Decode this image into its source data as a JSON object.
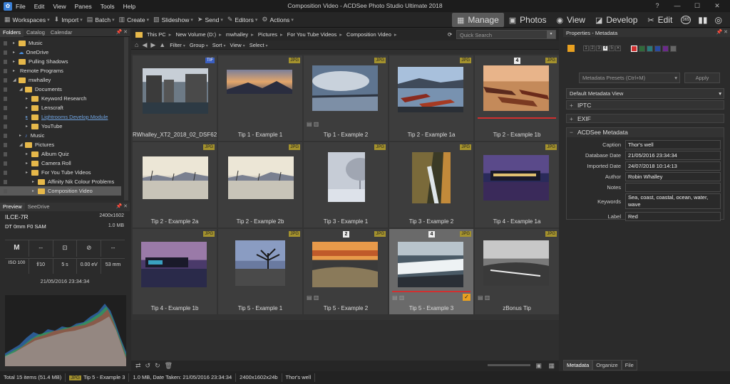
{
  "app": {
    "title": "Composition Video - ACDSee Photo Studio Ultimate 2018"
  },
  "menu": [
    "File",
    "Edit",
    "View",
    "Panes",
    "Tools",
    "Help"
  ],
  "toolbar": {
    "workspaces": "Workspaces",
    "import": "Import",
    "batch": "Batch",
    "create": "Create",
    "slideshow": "Slideshow",
    "send": "Send",
    "editors": "Editors",
    "actions": "Actions"
  },
  "modes": {
    "manage": "Manage",
    "photos": "Photos",
    "view": "View",
    "develop": "Develop",
    "edit": "Edit",
    "badge365": "365"
  },
  "left_tabs": [
    "Folders",
    "Catalog",
    "Calendar"
  ],
  "tree": [
    {
      "label": "Music",
      "depth": 2,
      "type": "folder"
    },
    {
      "label": "OneDrive",
      "depth": 2,
      "type": "cloud"
    },
    {
      "label": "Pulling Shadows",
      "depth": 2,
      "type": "folder"
    },
    {
      "label": "Remote Programs",
      "depth": 2,
      "type": "none"
    },
    {
      "label": "mwhalley",
      "depth": 2,
      "type": "folder"
    },
    {
      "label": "Documents",
      "depth": 3,
      "type": "folder"
    },
    {
      "label": "Keyword Research",
      "depth": 4,
      "type": "folder"
    },
    {
      "label": "Lenscraft",
      "depth": 4,
      "type": "folder"
    },
    {
      "label": "Lightrooms Develop Module",
      "depth": 4,
      "type": "folder",
      "link": true
    },
    {
      "label": "YouTube",
      "depth": 4,
      "type": "folder"
    },
    {
      "label": "Music",
      "depth": 3,
      "type": "music"
    },
    {
      "label": "Pictures",
      "depth": 3,
      "type": "folder"
    },
    {
      "label": "Album Quiz",
      "depth": 4,
      "type": "folder"
    },
    {
      "label": "Camera Roll",
      "depth": 4,
      "type": "folder"
    },
    {
      "label": "For You Tube Videos",
      "depth": 4,
      "type": "folder"
    },
    {
      "label": "Affinity Nik Colour Problems",
      "depth": 5,
      "type": "folder"
    },
    {
      "label": "Composition Video",
      "depth": 5,
      "type": "folder",
      "selected": true
    }
  ],
  "preview_tabs": [
    "Preview",
    "SeeDrive"
  ],
  "camera": {
    "model": "ILCE-7R",
    "resolution": "2400x1602",
    "lens": "DT 0mm F0 SAM",
    "size": "1.0 MB",
    "mode": "M",
    "dash1": "--",
    "dash2": "--",
    "iso": "ISO 100",
    "aperture": "f/10",
    "shutter": "5 s",
    "ev": "0.00 eV",
    "focal": "53 mm",
    "date": "21/05/2016 23:34:34"
  },
  "address": {
    "path": [
      "This PC",
      "New Volume (D:)",
      "mwhalley",
      "Pictures",
      "For You Tube Videos",
      "Composition Video"
    ],
    "search_placeholder": "Quick Search"
  },
  "nav": [
    "Filter",
    "Group",
    "Sort",
    "View",
    "Select"
  ],
  "thumbnails": [
    {
      "caption": "RWhalley_XT2_2018_02_DSF62",
      "badge": "TIF",
      "num": "",
      "img": "city"
    },
    {
      "caption": "Tip 1 - Example 1",
      "badge": "JPG",
      "num": "",
      "img": "lake"
    },
    {
      "caption": "Tip 1 - Example 2",
      "badge": "JPG",
      "num": "",
      "img": "cloud"
    },
    {
      "caption": "Tip 2 - Example 1a",
      "badge": "JPG",
      "num": "",
      "img": "boats"
    },
    {
      "caption": "Tip 2 - Example 1b",
      "badge": "JPG",
      "num": "4",
      "img": "boats2"
    },
    {
      "caption": "Tip 2 - Example 2a",
      "badge": "JPG",
      "num": "",
      "img": "harbour"
    },
    {
      "caption": "Tip 2 - Example 2b",
      "badge": "JPG",
      "num": "",
      "img": "harbour"
    },
    {
      "caption": "Tip 3 - Example 1",
      "badge": "JPG",
      "num": "",
      "img": "mist"
    },
    {
      "caption": "Tip 3 - Example 2",
      "badge": "JPG",
      "num": "",
      "img": "falls"
    },
    {
      "caption": "Tip 4 - Example 1a",
      "badge": "JPG",
      "num": "",
      "img": "dusk"
    },
    {
      "caption": "Tip 4 - Example 1b",
      "badge": "JPG",
      "num": "",
      "img": "dusk2"
    },
    {
      "caption": "Tip 5 - Example 1",
      "badge": "JPG",
      "num": "",
      "img": "tree"
    },
    {
      "caption": "Tip 5 - Example 2",
      "badge": "JPG",
      "num": "2",
      "img": "sunset"
    },
    {
      "caption": "Tip 5 - Example 3",
      "badge": "JPG",
      "num": "4",
      "img": "water",
      "selected": true
    },
    {
      "caption": "zBonus Tip",
      "badge": "JPG",
      "num": "",
      "img": "bw"
    }
  ],
  "right": {
    "header": "Properties - Metadata",
    "presets": "Metadata Presets (Ctrl+M)",
    "apply": "Apply",
    "view": "Default Metadata View",
    "sections": [
      "IPTC",
      "EXIF",
      "ACDSee Metadata"
    ],
    "fields": [
      {
        "label": "Caption",
        "value": "Thor's well"
      },
      {
        "label": "Database Date",
        "value": "21/05/2016 23:34:34"
      },
      {
        "label": "Imported Date",
        "value": "24/07/2018 10:14:13"
      },
      {
        "label": "Author",
        "value": "Robin Whalley"
      },
      {
        "label": "Notes",
        "value": ""
      },
      {
        "label": "Keywords",
        "value": "Sea, coast, coastal, ocean, water, wave"
      },
      {
        "label": "Label",
        "value": "Red"
      }
    ],
    "ratings": [
      "1",
      "2",
      "3",
      "4",
      "5"
    ],
    "colors": [
      "#d03030",
      "#2f6a3a",
      "#2a7a7a",
      "#2a4aa0",
      "#6a2a8a",
      "#666666"
    ],
    "tabs": [
      "Metadata",
      "Organize",
      "File"
    ]
  },
  "status": {
    "total": "Total 15 items  (51.4 MB)",
    "badge": "JPG",
    "file": "Tip 5 - Example 3",
    "info": "1.0 MB, Date Taken: 21/05/2016 23:34:34",
    "dims": "2400x1602x24b",
    "caption": "Thor's well"
  }
}
